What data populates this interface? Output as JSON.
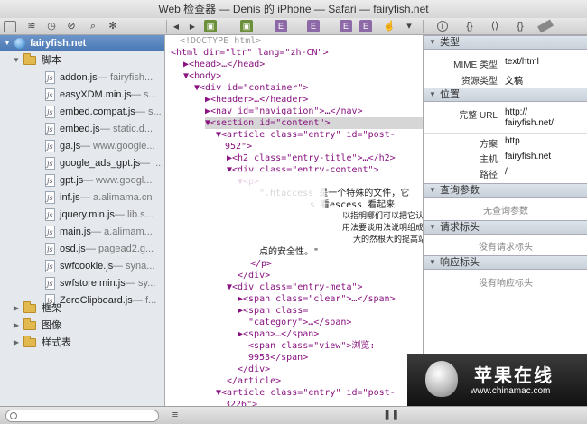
{
  "window": {
    "title": "Web 检查器 — Denis 的 iPhone — Safari — fairyfish.net"
  },
  "toolbar": {
    "icons": [
      "sidebar-icon",
      "storage-icon",
      "timeline-icon",
      "console-icon",
      "search-icon",
      "settings-icon"
    ],
    "nav_back": "◀",
    "nav_fwd": "▶",
    "crumbs": [
      "E",
      "E",
      "E",
      "E",
      "E"
    ],
    "right_tabs": [
      "i",
      "{}",
      "⟨⟩",
      "ruler"
    ]
  },
  "left": {
    "root": "fairyfish.net",
    "scripts_folder": "脚本",
    "files": [
      {
        "name": "addon.js",
        "src": " — fairyfish..."
      },
      {
        "name": "easyXDM.min.js",
        "src": " — s..."
      },
      {
        "name": "embed.compat.js",
        "src": " — s..."
      },
      {
        "name": "embed.js",
        "src": " — static.d..."
      },
      {
        "name": "ga.js",
        "src": " — www.google..."
      },
      {
        "name": "google_ads_gpt.js",
        "src": " — ..."
      },
      {
        "name": "gpt.js",
        "src": " — www.googl..."
      },
      {
        "name": "inf.js",
        "src": " — a.alimama.cn"
      },
      {
        "name": "jquery.min.js",
        "src": " — lib.s..."
      },
      {
        "name": "main.js",
        "src": " — a.alimam..."
      },
      {
        "name": "osd.js",
        "src": " — pagead2.g..."
      },
      {
        "name": "swfcookie.js",
        "src": " — syna..."
      },
      {
        "name": "swfstore.min.js",
        "src": " — sy..."
      },
      {
        "name": "ZeroClipboard.js",
        "src": " — f..."
      }
    ],
    "frames_folder": "框架",
    "images_folder": "图像",
    "styles_folder": "样式表"
  },
  "code": {
    "doctype": "<!DOCTYPE html>",
    "l_html": "<html dir=\"ltr\" lang=\"zh-CN\">",
    "l_head": "▶<head>…</head>",
    "l_body": "▼<body>",
    "l_container": "▼<div id=\"container\">",
    "l_header": "▶<header>…</header>",
    "l_nav": "▶<nav id=\"navigation\">…</nav>",
    "l_section": "▼<section id=\"content\">",
    "l_article": "▼<article class=\"entry\" id=\"post-",
    "l_article_b": "952\">",
    "l_h2": "▶<h2 class=\"entry-title\">…</h2>",
    "l_div_content": "▼<div class=\"entry-content\">",
    "l_p": "▼<p>",
    "l_text1": "\".htaccess 是一个特殊的文件，它",
    "l_text2": "s 看escess 看起来",
    "l_text3": "以指明哪们可以把它认",
    "l_text4": "用法要谈用法说明组成",
    "l_text5": "大的然根大的提高站",
    "l_text6": "点的安全性。\"",
    "l_p_close": "</p>",
    "l_div_close": "</div>",
    "l_meta": "▼<div class=\"entry-meta\">",
    "l_span_clear": "▶<span class=\"clear\">…</span>",
    "l_span_cat": "▶<span class=",
    "l_span_cat_b": "\"category\">…</span>",
    "l_span": "▶<span>…</span>",
    "l_span_view": "<span class=\"view\">浏览:",
    "l_span_view_b": "9953</span>",
    "l_div_close2": "</div>",
    "l_article_close": "</article>",
    "l_article2": "▼<article class=\"entry\" id=\"post-",
    "l_article2_b": "3226\">",
    "l_h2b": "▶<h2 class=\"entry-title\">…</h2>",
    "l_div_content2": "▼<div class=\"entry-content\">"
  },
  "right": {
    "sec_type": "类型",
    "mime_key": "MIME 类型",
    "mime_val": "text/html",
    "restype_key": "资源类型",
    "restype_val": "文稿",
    "sec_location": "位置",
    "url_key": "完整 URL",
    "url_val_1": "http://",
    "url_val_2": "fairyfish.net/",
    "scheme_key": "方案",
    "scheme_val": "http",
    "host_key": "主机",
    "host_val": "fairyfish.net",
    "path_key": "路径",
    "path_val": "/",
    "sec_query": "查询参数",
    "query_empty": "无查询参数",
    "sec_req": "请求标头",
    "req_empty": "没有请求标头",
    "sec_resp": "响应标头",
    "resp_empty": "没有响应标头"
  },
  "watermark": {
    "title": "苹果在线",
    "url": "www.chinamac.com"
  }
}
